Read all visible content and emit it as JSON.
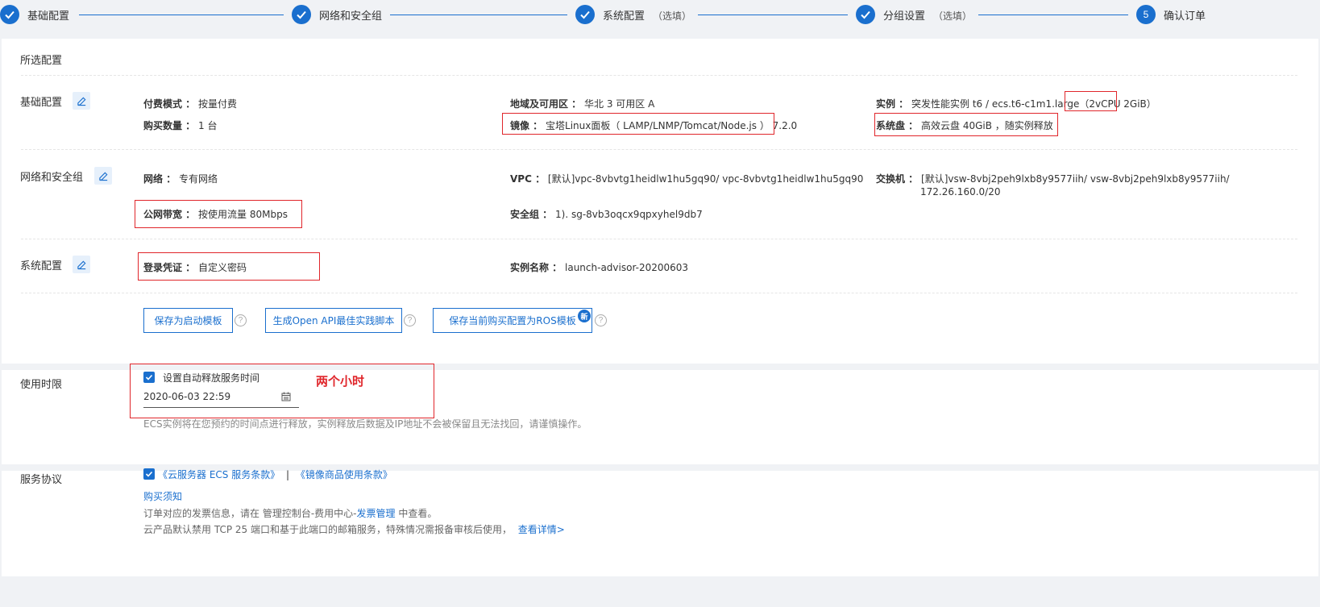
{
  "stepper": {
    "steps": [
      {
        "label": "基础配置",
        "optional": ""
      },
      {
        "label": "网络和安全组",
        "optional": ""
      },
      {
        "label": "系统配置",
        "optional": "（选填）"
      },
      {
        "label": "分组设置",
        "optional": "（选填）"
      },
      {
        "label": "确认订单",
        "optional": "",
        "number": "5"
      }
    ]
  },
  "selected": {
    "title": "所选配置",
    "basic": {
      "title": "基础配置",
      "billing_label": "付费模式 ：",
      "billing_value": "按量付费",
      "qty_label": "购买数量 ：",
      "qty_value": "1 台",
      "region_label": "地域及可用区 ：",
      "region_value": "华北 3 可用区 A",
      "image_label": "镜像 ：",
      "image_value": "宝塔Linux面板（ LAMP/LNMP/Tomcat/Node.js ） 7.2.0",
      "instance_label": "实例 ：",
      "instance_value": "突发性能实例 t6 / ecs.t6-c1m1.large（",
      "instance_spec": "2vCPU 2GiB",
      "instance_close": "）",
      "disk_label": "系统盘 ：",
      "disk_value": "高效云盘 40GiB ，随实例释放"
    },
    "network": {
      "title": "网络和安全组",
      "net_label": "网络 ：",
      "net_value": "专有网络",
      "vpc_label": "VPC ：",
      "vpc_value": "[默认]vpc-8vbvtg1heidlw1hu5gq90/ vpc-8vbvtg1heidlw1hu5gq90",
      "vsw_label": "交换机 ：",
      "vsw_value": "[默认]vsw-8vbj2peh9lxb8y9577iih/ vsw-8vbj2peh9lxb8y9577iih/",
      "vsw_cidr": "172.26.160.0/20",
      "bw_label": "公网带宽 ：",
      "bw_value": "按使用流量 80Mbps",
      "sg_label": "安全组 ：",
      "sg_value": "1). sg-8vb3oqcx9qpxyhel9db7"
    },
    "system": {
      "title": "系统配置",
      "login_label": "登录凭证 ：",
      "login_value": "自定义密码",
      "name_label": "实例名称 ：",
      "name_value": "launch-advisor-20200603"
    },
    "buttons": {
      "save_template": "保存为启动模板",
      "gen_api": "生成Open API最佳实践脚本",
      "save_ros": "保存当前购买配置为ROS模板",
      "new_badge": "新",
      "help": "?"
    }
  },
  "duration": {
    "title": "使用时限",
    "auto_release_label": "设置自动释放服务时间",
    "annotation": "两个小时",
    "date_value": "2020-06-03 22:59",
    "note": "ECS实例将在您预约的时间点进行释放，实例释放后数据及IP地址不会被保留且无法找回，请谨慎操作。"
  },
  "agreement": {
    "title": "服务协议",
    "terms1": "《云服务器 ECS 服务条款》",
    "sep": "|",
    "terms2": "《镜像商品使用条款》",
    "purchase_notice": "购买须知",
    "invoice_prefix": "订单对应的发票信息，请在 管理控制台-费用中心-",
    "invoice_link": "发票管理",
    "invoice_suffix": " 中查看。",
    "port_text": "云产品默认禁用 TCP 25 端口和基于此端口的邮箱服务，特殊情况需报备审核后使用，",
    "details_link": "查看详情>"
  },
  "colors": {
    "accent": "#1a6fce",
    "annotation_red": "#e0262b"
  }
}
